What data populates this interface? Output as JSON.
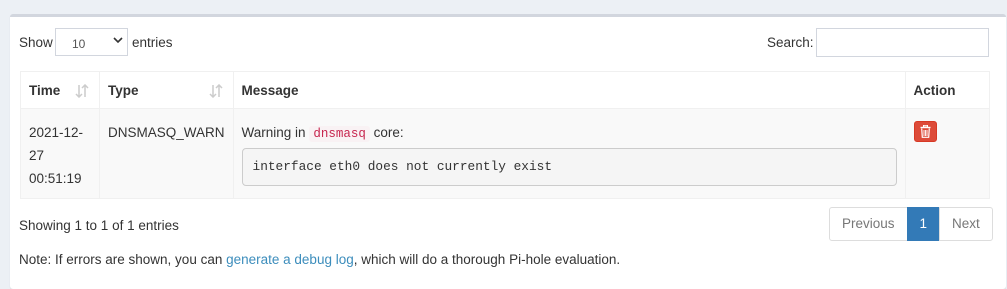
{
  "length_menu": {
    "show_label": "Show",
    "selected": "10",
    "entries_label": "entries"
  },
  "search": {
    "label": "Search:",
    "value": ""
  },
  "table": {
    "headers": {
      "time": "Time",
      "type": "Type",
      "message": "Message",
      "action": "Action"
    },
    "rows": [
      {
        "time_date": "2021-12-",
        "time_date2": "27",
        "time_clock": "00:51:19",
        "type": "DNSMASQ_WARN",
        "msg_prefix": "Warning in",
        "msg_code": "dnsmasq",
        "msg_suffix": "core:",
        "msg_detail": "interface eth0 does not currently exist"
      }
    ]
  },
  "info": "Showing 1 to 1 of 1 entries",
  "pagination": {
    "previous": "Previous",
    "current": "1",
    "next": "Next"
  },
  "note": {
    "prefix": "Note: If errors are shown, you can",
    "link": "generate a debug log",
    "suffix": ", which will do a thorough Pi-hole evaluation."
  },
  "colors": {
    "delete_button": "#dd4b39",
    "link": "#3c8dbc",
    "active_page": "#337ab7",
    "code_text": "#c7254e"
  },
  "icons": {
    "delete": "trash-icon",
    "sort": "sort-arrows-icon",
    "select": "chevron-down-icon"
  }
}
